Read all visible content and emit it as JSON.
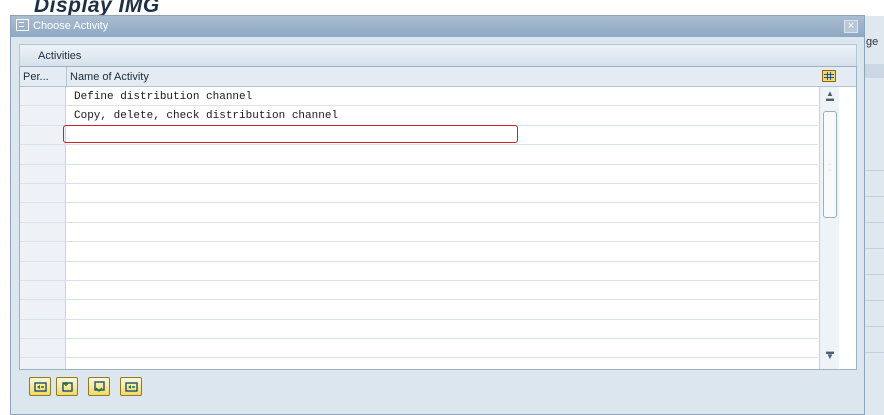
{
  "background": {
    "title": "Display IMG",
    "right_fragment": "ge"
  },
  "dialog": {
    "title": "Choose Activity",
    "close_label": "×",
    "tab": "Activities",
    "columns": {
      "per": "Per...",
      "name": "Name of Activity"
    },
    "rows": [
      "Define distribution channel",
      "Copy, delete, check distribution channel",
      "",
      "",
      "",
      "",
      "",
      "",
      "",
      "",
      "",
      "",
      "",
      "",
      ""
    ],
    "selected_row_index": 1,
    "footer_buttons": [
      {
        "icon": "continue-icon"
      },
      {
        "icon": "new-entry-icon"
      },
      {
        "icon": "copy-icon"
      },
      {
        "icon": "cancel-icon"
      }
    ]
  }
}
